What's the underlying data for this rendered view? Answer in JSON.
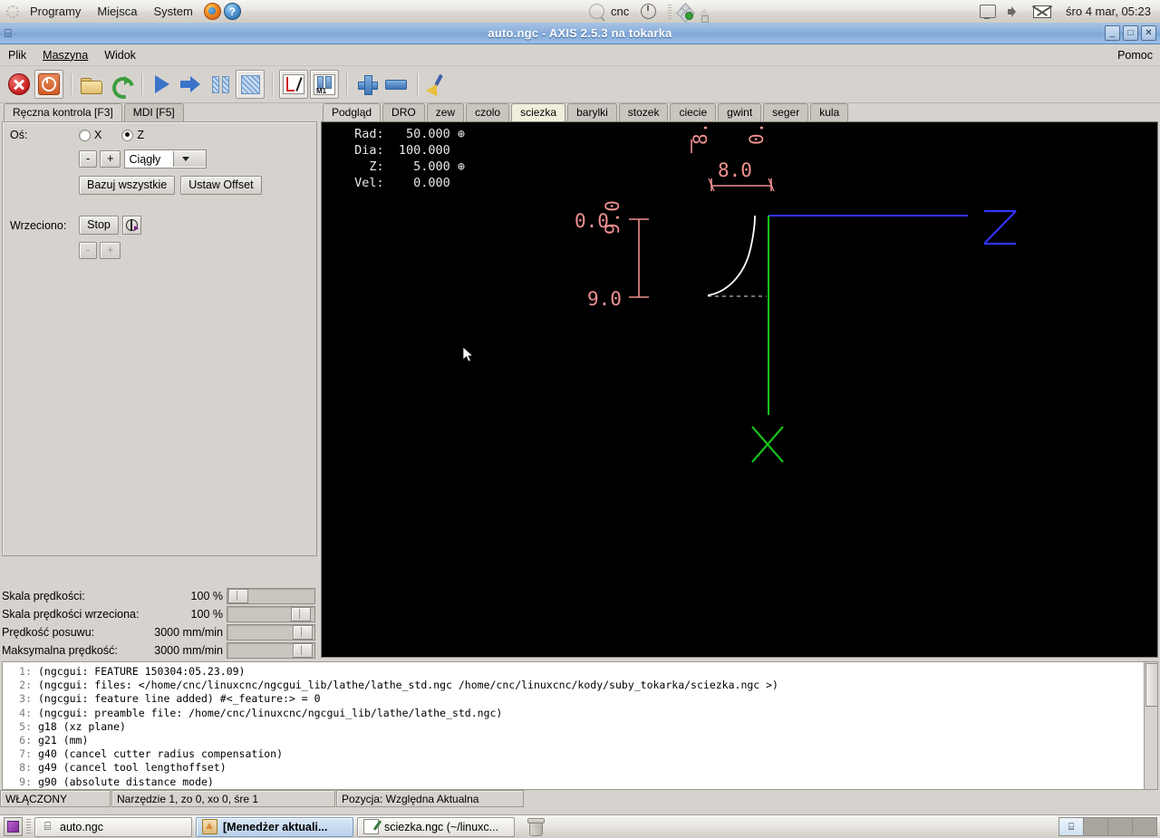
{
  "gnome_panel": {
    "menus": [
      "Programy",
      "Miejsca",
      "System"
    ],
    "icons": [
      "ubuntu-logo-icon",
      "firefox-icon",
      "help-icon"
    ],
    "tray_left_label": "cnc",
    "tray_icons": [
      "cnc-search-icon",
      "power-icon",
      "dropbox-icon",
      "update-manager-icon"
    ],
    "tray_right_icons": [
      "display-icon",
      "volume-icon",
      "mail-icon"
    ],
    "clock": "śro  4 mar, 05:23"
  },
  "window": {
    "title": "auto.ngc - AXIS 2.5.3 na tokarka",
    "icon": "axis-window-icon",
    "buttons": {
      "minimize": "_",
      "maximize": "□",
      "close": "✕"
    }
  },
  "menubar": {
    "items": [
      "Plik",
      "Maszyna",
      "Widok"
    ],
    "help": "Pomoc"
  },
  "toolbar": {
    "buttons": [
      {
        "name": "estop-button",
        "icon": "emergency-stop-icon"
      },
      {
        "name": "machine-power-button",
        "icon": "power-on-icon"
      },
      {
        "name": "open-file-button",
        "icon": "folder-open-icon"
      },
      {
        "name": "reload-file-button",
        "icon": "reload-icon"
      },
      {
        "name": "run-program-button",
        "icon": "play-icon"
      },
      {
        "name": "step-program-button",
        "icon": "step-arrow-icon"
      },
      {
        "name": "pause-program-button",
        "icon": "pause-icon"
      },
      {
        "name": "stop-program-button",
        "icon": "stop-square-icon"
      },
      {
        "name": "block-delete-button",
        "icon": "block-delete-icon"
      },
      {
        "name": "optional-stop-button",
        "icon": "optional-stop-m1-icon"
      },
      {
        "name": "zoom-in-button",
        "icon": "plus-icon"
      },
      {
        "name": "zoom-out-button",
        "icon": "minus-icon"
      },
      {
        "name": "clear-plot-button",
        "icon": "broom-icon"
      }
    ]
  },
  "left_pane": {
    "tabs": [
      {
        "label": "Ręczna kontrola [F3]",
        "active": true
      },
      {
        "label": "MDI [F5]",
        "active": false
      }
    ],
    "axis_label": "Oś:",
    "axes": [
      {
        "label": "X",
        "selected": false
      },
      {
        "label": "Z",
        "selected": true
      }
    ],
    "jog_minus": "-",
    "jog_plus": "+",
    "jog_mode": "Ciągły",
    "home_all_button": "Bazuj wszystkie",
    "set_offset_button": "Ustaw Offset",
    "spindle_label": "Wrzeciono:",
    "spindle_stop_button": "Stop",
    "spindle_dir_icon": "spindle-direction-icon",
    "spindle_minus": "-",
    "spindle_plus": "+"
  },
  "sliders": [
    {
      "name": "Skala prędkości:",
      "value": "100 %",
      "thumb_pct": 8
    },
    {
      "name": "Skala prędkości wrzeciona:",
      "value": "100 %",
      "thumb_pct": 74
    },
    {
      "name": "Prędkość posuwu:",
      "value": "3000 mm/min",
      "thumb_pct": 76
    },
    {
      "name": "Maksymalna prędkość:",
      "value": "3000 mm/min",
      "thumb_pct": 76
    }
  ],
  "plot_tabs": [
    {
      "label": "Podgląd",
      "active": true,
      "highlight": false
    },
    {
      "label": "DRO",
      "active": false,
      "highlight": false
    },
    {
      "label": "zew",
      "active": false,
      "highlight": false
    },
    {
      "label": "czolo",
      "active": false,
      "highlight": false
    },
    {
      "label": "sciezka",
      "active": false,
      "highlight": true
    },
    {
      "label": "barylki",
      "active": false,
      "highlight": false
    },
    {
      "label": "stozek",
      "active": false,
      "highlight": false
    },
    {
      "label": "ciecie",
      "active": false,
      "highlight": false
    },
    {
      "label": "gwint",
      "active": false,
      "highlight": false
    },
    {
      "label": "seger",
      "active": false,
      "highlight": false
    },
    {
      "label": "kula",
      "active": false,
      "highlight": false
    }
  ],
  "dro": {
    "rad_label": "Rad:",
    "rad_value": "50.000",
    "dia_label": "Dia:",
    "dia_value": "100.000",
    "z_label": "Z:",
    "z_value": "5.000",
    "vel_label": "Vel:",
    "vel_value": "0.000"
  },
  "plot_annotations": {
    "top_left_vertical": "8.0",
    "top_right_vertical": "0.0",
    "top_horizontal": "8.0",
    "left_top": "0.0",
    "left_middle_vertical": "9.0",
    "left_bottom": "9.0",
    "axis_z_label": "Z",
    "axis_x_label": "X",
    "colors": {
      "background": "#000000",
      "dimension": "#f09090",
      "z_axis": "#3030ff",
      "x_axis": "#20c020",
      "toolpath": "#ffffff",
      "dro_text": "#e8e8e8"
    }
  },
  "gcode": [
    {
      "n": "1:",
      "text": "(ngcgui: FEATURE 150304:05.23.09)"
    },
    {
      "n": "2:",
      "text": "(ngcgui: files: </home/cnc/linuxcnc/ngcgui_lib/lathe/lathe_std.ngc /home/cnc/linuxcnc/kody/suby_tokarka/sciezka.ngc >)"
    },
    {
      "n": "3:",
      "text": "(ngcgui: feature line added) #<_feature:> = 0"
    },
    {
      "n": "4:",
      "text": "(ngcgui: preamble file: /home/cnc/linuxcnc/ngcgui_lib/lathe/lathe_std.ngc)"
    },
    {
      "n": "5:",
      "text": "g18 (xz plane)"
    },
    {
      "n": "6:",
      "text": "g21 (mm)"
    },
    {
      "n": "7:",
      "text": "g40 (cancel cutter radius compensation)"
    },
    {
      "n": "8:",
      "text": "g49 (cancel tool lengthoffset)"
    },
    {
      "n": "9:",
      "text": "g90 (absolute distance mode)"
    }
  ],
  "statusbar": [
    "WŁĄCZONY",
    "Narzędzie 1, zo 0, xo 0, śre 1",
    "Pozycja: Względna Aktualna"
  ],
  "taskbar": {
    "show_desktop_icon": "show-desktop-icon",
    "tasks": [
      {
        "label": "auto.ngc",
        "icon": "axis-task-icon",
        "active": false
      },
      {
        "label": "[Menedżer aktuali...",
        "icon": "update-manager-task-icon",
        "active": true
      },
      {
        "label": "sciezka.ngc (~/linuxc...",
        "icon": "gedit-task-icon",
        "active": false
      }
    ],
    "trash_icon": "trash-icon",
    "workspaces": 4,
    "active_workspace": 1
  }
}
